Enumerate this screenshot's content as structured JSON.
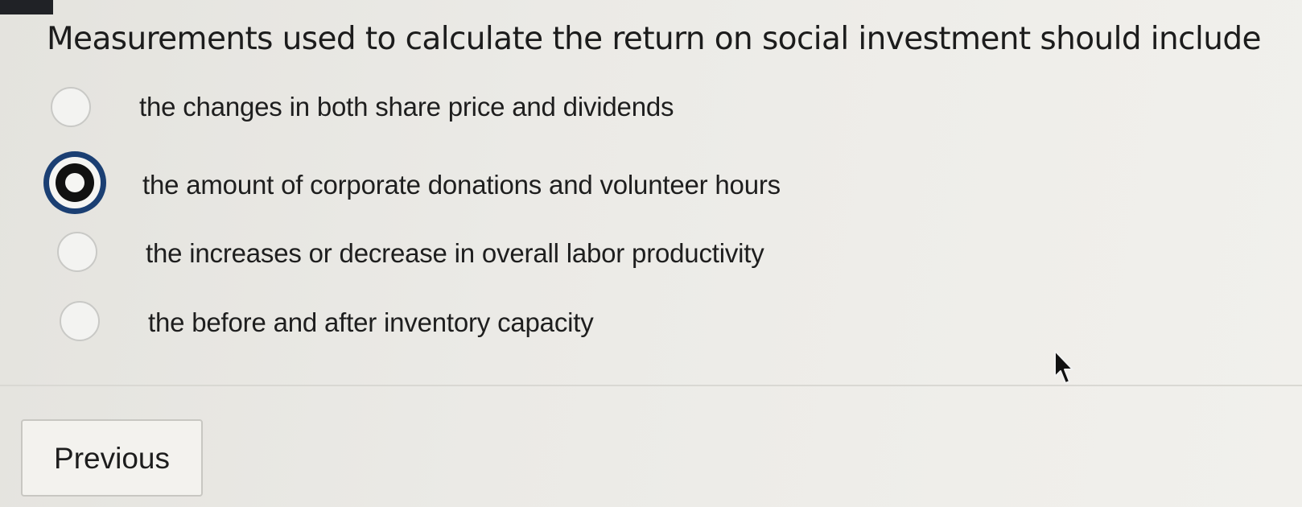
{
  "question": {
    "text": "Measurements used to calculate the return on social investment should include"
  },
  "options": [
    {
      "label": "the changes in both share price and dividends",
      "selected": false
    },
    {
      "label": "the amount of corporate donations and volunteer hours",
      "selected": true
    },
    {
      "label": "the increases or decrease in overall labor productivity",
      "selected": false
    },
    {
      "label": "the before and after inventory capacity",
      "selected": false
    }
  ],
  "navigation": {
    "previous_label": "Previous"
  },
  "icons": {
    "cursor": "mouse-pointer-icon"
  },
  "colors": {
    "selected_ring": "#1b3f73",
    "background": "#ebeae6"
  }
}
